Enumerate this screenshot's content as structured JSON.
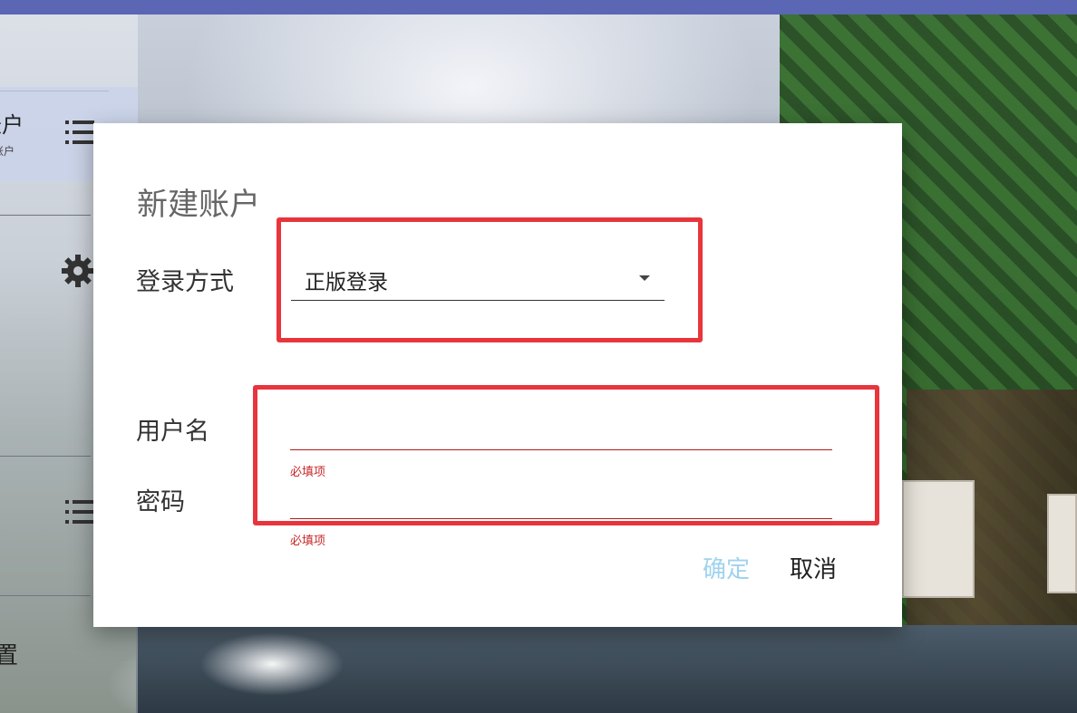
{
  "dialog": {
    "title": "新建账户",
    "login_method": {
      "label": "登录方式",
      "selected_value": "正版登录"
    },
    "username": {
      "label": "用户名",
      "value": "",
      "error": "必填项"
    },
    "password": {
      "label": "密码",
      "value": "",
      "error": "必填项"
    },
    "buttons": {
      "confirm": "确定",
      "cancel": "取消"
    }
  },
  "sidebar": {
    "account_label_partial": "账户",
    "account_sub_partial": "账户",
    "settings_label_partial": "置"
  },
  "colors": {
    "topbar": "#5b66b5",
    "error_red": "#c62828",
    "confirm_disabled": "#9fd2ee",
    "highlight_box": "#e8353d"
  },
  "icons": [
    "list-icon",
    "gear-icon",
    "list-icon",
    "dropdown-caret-icon"
  ]
}
